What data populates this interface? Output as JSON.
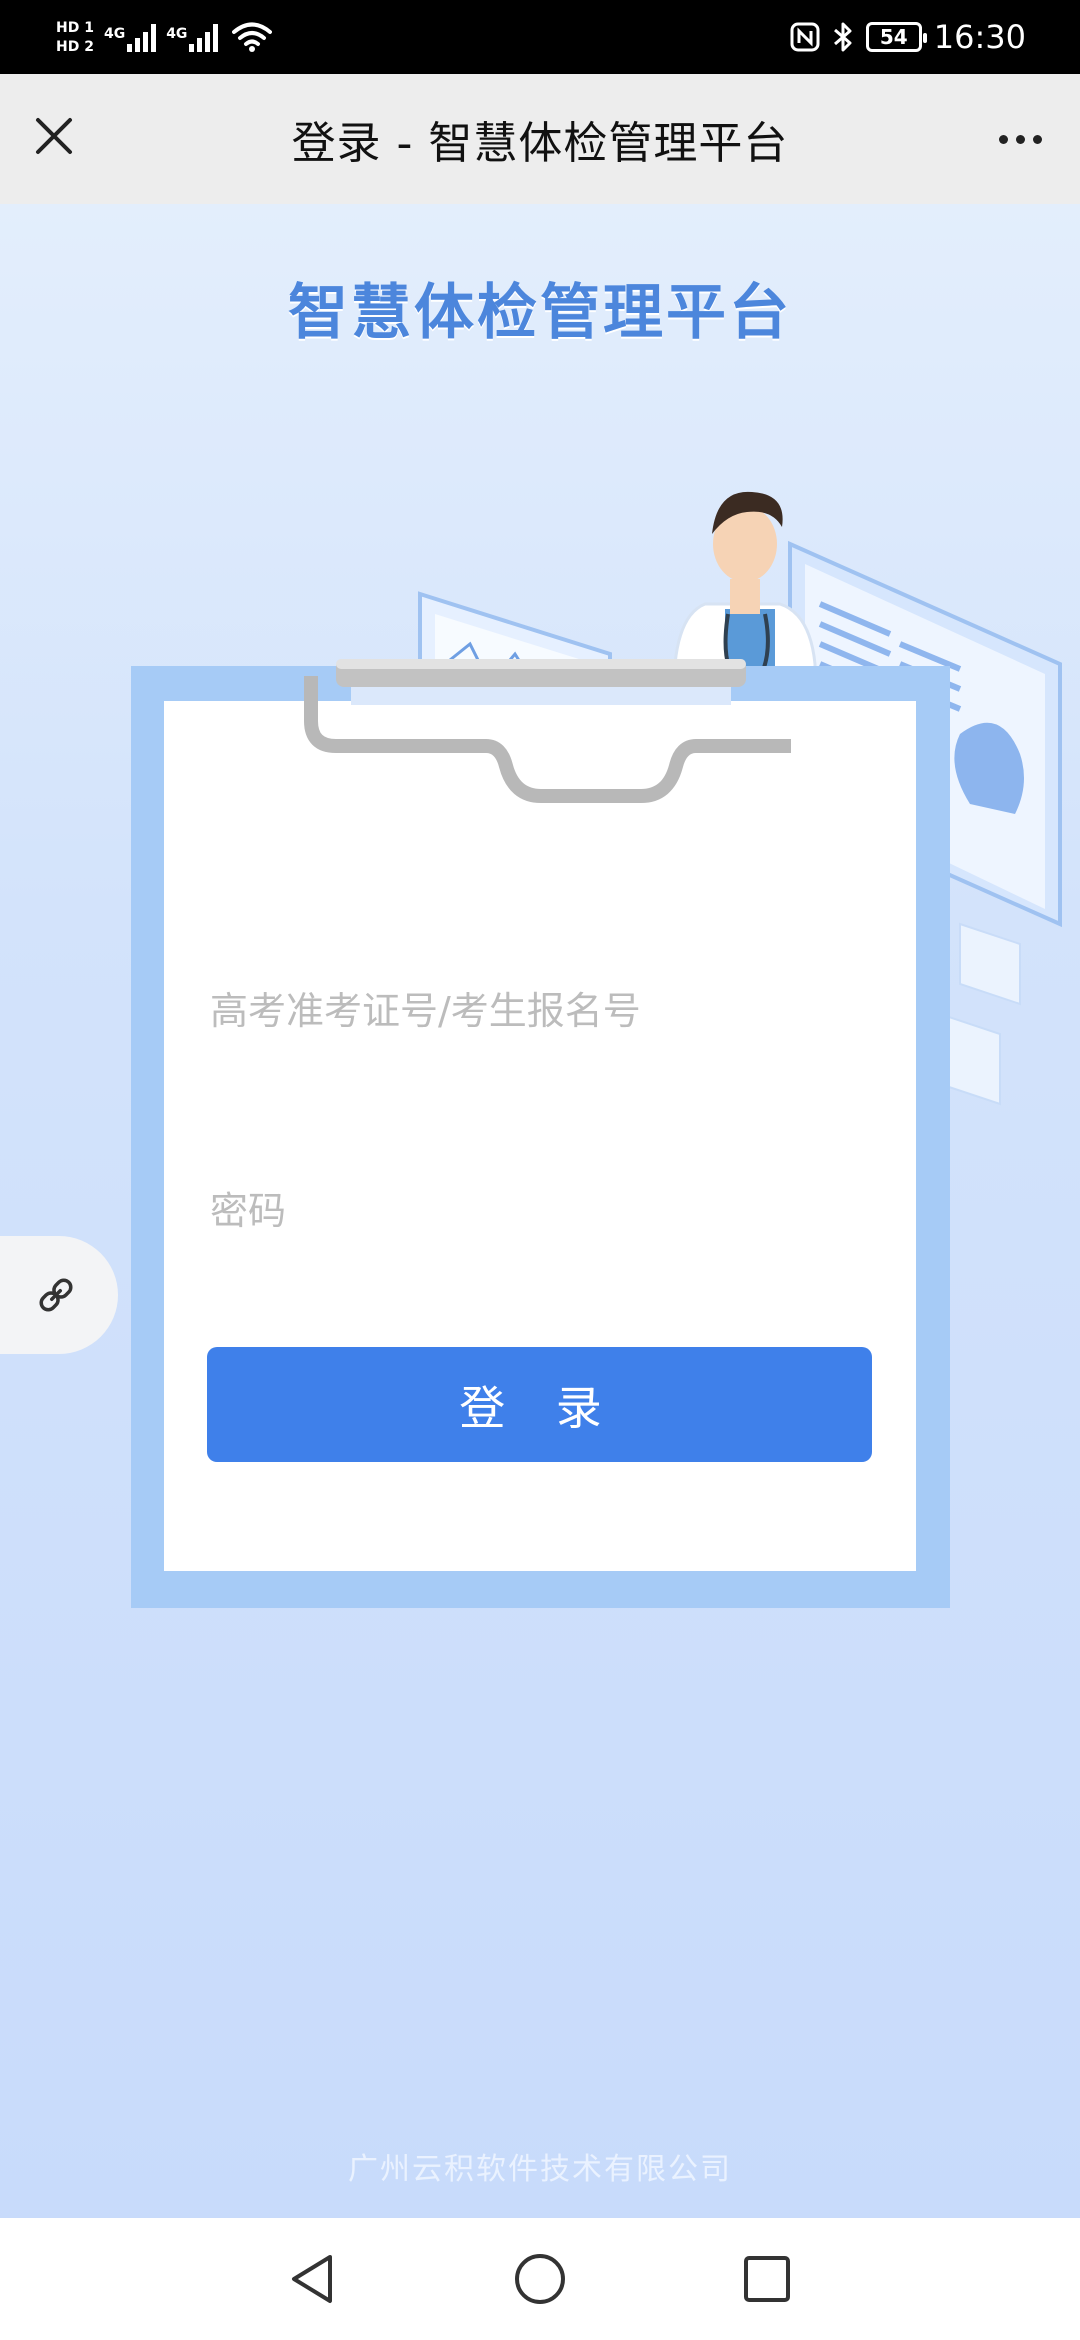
{
  "status_bar": {
    "hd1": "HD 1",
    "hd2": "HD 2",
    "net1": "4G",
    "net2": "4G",
    "nfc_icon": "nfc-icon",
    "bluetooth_icon": "bluetooth-icon",
    "battery": "54",
    "time": "16:30"
  },
  "title_bar": {
    "close_icon": "close-icon",
    "title": "登录 - 智慧体检管理平台",
    "more_icon": "more-dots-icon"
  },
  "hero": {
    "title": "智慧体检管理平台"
  },
  "login_form": {
    "username_placeholder": "高考准考证号/考生报名号",
    "username_value": "",
    "password_placeholder": "密码",
    "password_value": "",
    "login_label": "登 录"
  },
  "floating": {
    "link_icon": "link-icon"
  },
  "footer": {
    "company": "广州云积软件技术有限公司"
  },
  "nav_bar": {
    "back_icon": "back-triangle-icon",
    "home_icon": "home-circle-icon",
    "recents_icon": "recents-square-icon"
  },
  "colors": {
    "accent": "#3f80ea",
    "hero_title": "#4c86dc",
    "clipboard_frame": "#a6cbf6",
    "background": "#c9ddfb"
  }
}
